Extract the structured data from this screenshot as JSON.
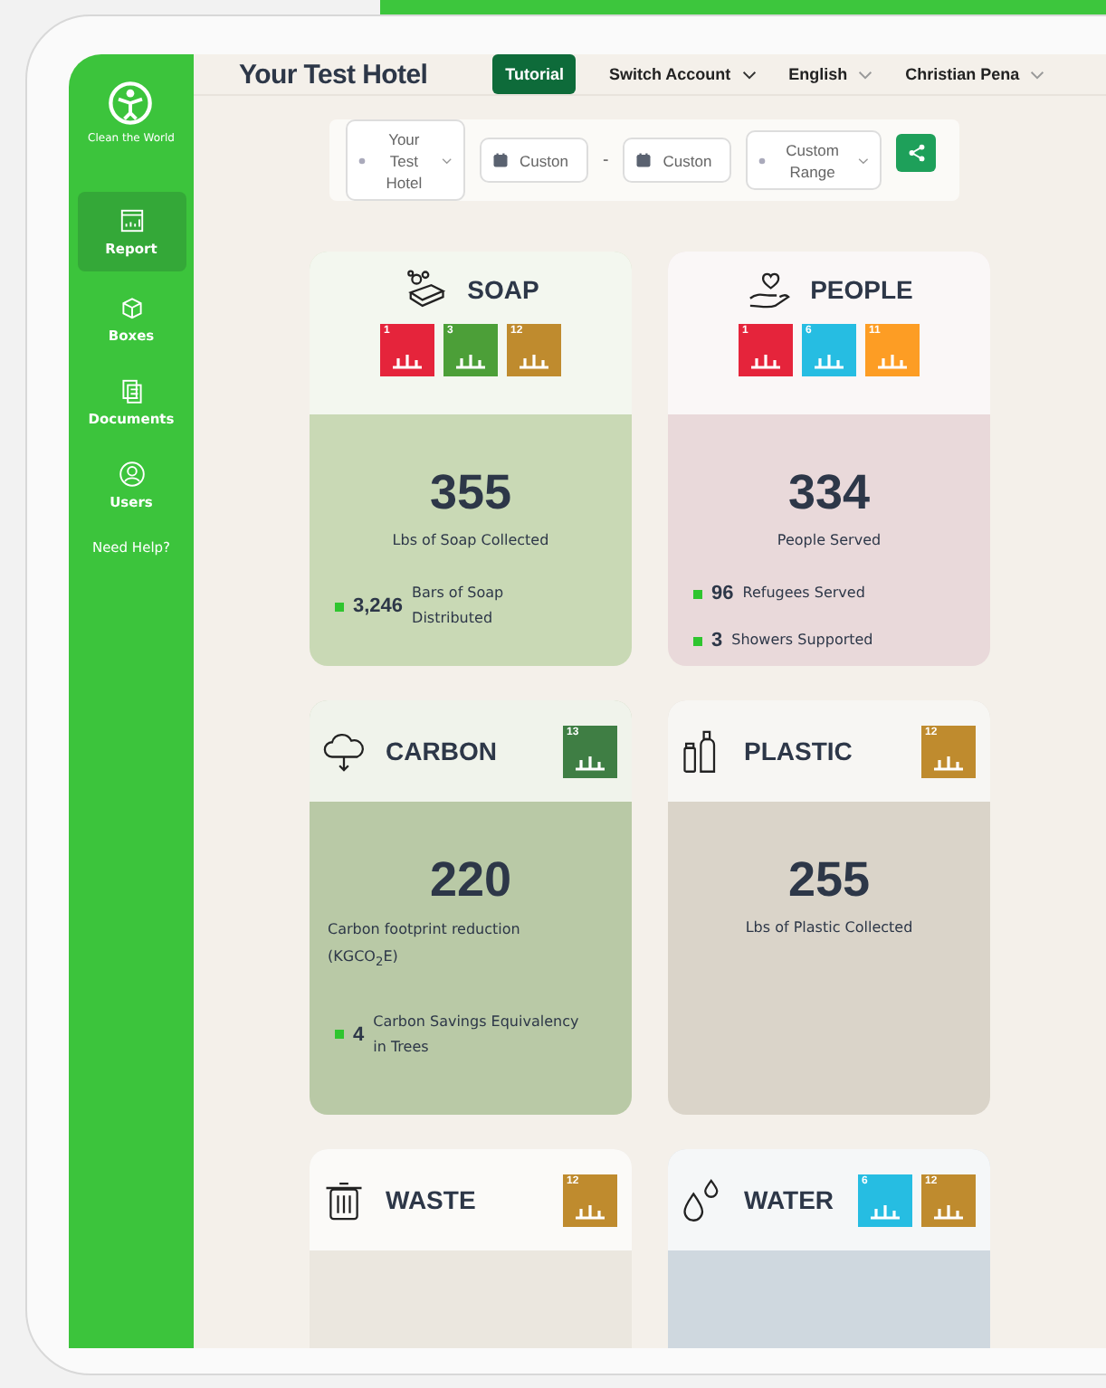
{
  "brand": {
    "name": "Clean the World"
  },
  "sidebar": {
    "items": [
      {
        "label": "Report",
        "selected": true
      },
      {
        "label": "Boxes",
        "selected": false
      },
      {
        "label": "Documents",
        "selected": false
      },
      {
        "label": "Users",
        "selected": false
      }
    ],
    "help": "Need Help?"
  },
  "header": {
    "title": "Your Test Hotel",
    "tutorial": "Tutorial",
    "menus": [
      "Switch Account",
      "English",
      "Christian Pena"
    ]
  },
  "filters": {
    "property": "Your Test Hotel",
    "start_date": "Custon",
    "separator": "-",
    "end_date": "Custon",
    "range": "Custom Range"
  },
  "cards": [
    {
      "kind": "soap",
      "title": "SOAP",
      "goals": [
        {
          "number": "1",
          "color": "#e5243b"
        },
        {
          "number": "3",
          "color": "#4c9f38"
        },
        {
          "number": "12",
          "color": "#bf8b2e"
        }
      ],
      "value": "355",
      "label": "Lbs of Soap Collected",
      "stats": [
        {
          "value": "3,246",
          "label": "Bars of Soap Distributed"
        }
      ]
    },
    {
      "kind": "people",
      "title": "PEOPLE",
      "goals": [
        {
          "number": "1",
          "color": "#e5243b"
        },
        {
          "number": "6",
          "color": "#26bde2"
        },
        {
          "number": "11",
          "color": "#fd9d24"
        }
      ],
      "value": "334",
      "label": "People Served",
      "stats": [
        {
          "value": "96",
          "label": "Refugees Served"
        },
        {
          "value": "3",
          "label": "Showers Supported"
        }
      ]
    },
    {
      "kind": "carbon",
      "title": "CARBON",
      "goals": [
        {
          "number": "13",
          "color": "#3f7e44"
        }
      ],
      "value": "220",
      "label": "Carbon footprint reduction (KGCO$_{2}$E)",
      "stats": [
        {
          "value": "4",
          "label": "Carbon Savings Equivalency in Trees"
        }
      ]
    },
    {
      "kind": "plastic",
      "title": "PLASTIC",
      "goals": [
        {
          "number": "12",
          "color": "#bf8b2e"
        }
      ],
      "value": "255",
      "label": "Lbs of Plastic Collected"
    },
    {
      "kind": "waste",
      "title": "WASTE",
      "goals": [
        {
          "number": "12",
          "color": "#bf8b2e"
        }
      ]
    },
    {
      "kind": "water",
      "title": "WATER",
      "goals": [
        {
          "number": "6",
          "color": "#26bde2"
        },
        {
          "number": "12",
          "color": "#bf8b2e"
        }
      ]
    }
  ]
}
